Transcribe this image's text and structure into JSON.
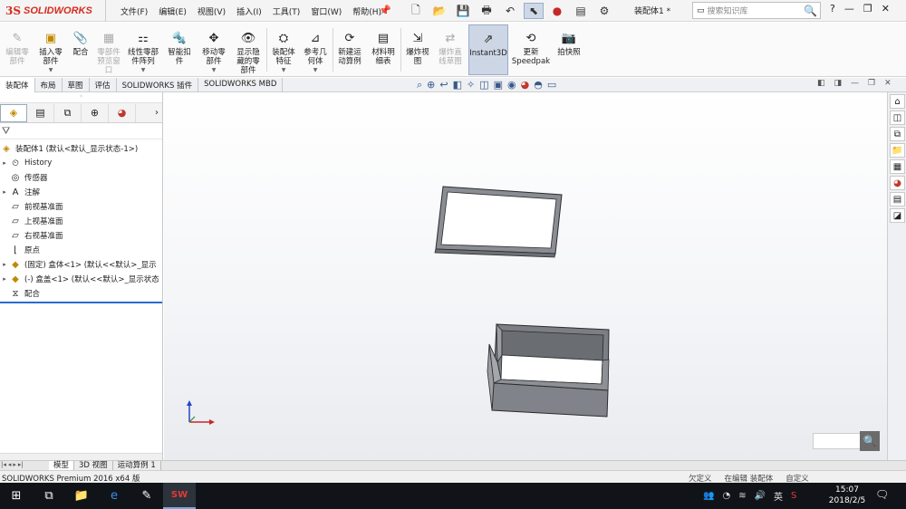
{
  "app": {
    "logo_ds": "3S",
    "logo_text": "SOLIDWORKS",
    "document_title": "装配体1 *"
  },
  "menu": [
    "文件(F)",
    "编辑(E)",
    "视图(V)",
    "插入(I)",
    "工具(T)",
    "窗口(W)",
    "帮助(H)"
  ],
  "quick_access": [
    "new-doc",
    "open",
    "save",
    "print",
    "undo",
    "select",
    "rebuild",
    "file-props",
    "options"
  ],
  "search": {
    "placeholder": "搜索知识库"
  },
  "title_buttons": {
    "help": "?",
    "minimize": "—",
    "restore": "❐",
    "close": "✕"
  },
  "ribbon": [
    {
      "label": "编辑零\n部件",
      "icon": "edit-part-icon",
      "disabled": true
    },
    {
      "label": "插入零\n部件",
      "icon": "insert-component-icon",
      "disabled": false,
      "dropdown": true
    },
    {
      "label": "配合",
      "icon": "mate-icon",
      "disabled": false
    },
    {
      "label": "零部件\n预览窗\n口",
      "icon": "component-preview-icon",
      "disabled": true
    },
    {
      "label": "线性零部\n件阵列",
      "icon": "linear-pattern-icon",
      "disabled": false,
      "dropdown": true
    },
    {
      "label": "智能扣\n件",
      "icon": "smart-fasteners-icon",
      "disabled": false
    },
    {
      "label": "移动零\n部件",
      "icon": "move-component-icon",
      "disabled": false,
      "dropdown": true
    },
    {
      "label": "显示隐\n藏的零\n部件",
      "icon": "show-hidden-icon",
      "disabled": false
    },
    {
      "label": "装配体\n特征",
      "icon": "assembly-features-icon",
      "disabled": false,
      "dropdown": true
    },
    {
      "label": "参考几\n何体",
      "icon": "reference-geometry-icon",
      "disabled": false,
      "dropdown": true
    },
    {
      "label": "新建运\n动算例",
      "icon": "new-motion-study-icon",
      "disabled": false
    },
    {
      "label": "材料明\n细表",
      "icon": "bom-icon",
      "disabled": false
    },
    {
      "label": "爆炸视\n图",
      "icon": "exploded-view-icon",
      "disabled": false
    },
    {
      "label": "爆炸直\n线草图",
      "icon": "explode-line-sketch-icon",
      "disabled": true
    },
    {
      "label": "Instant3D",
      "icon": "instant3d-icon",
      "disabled": false,
      "selected": true
    },
    {
      "label": "更新\nSpeedpak",
      "icon": "speedpak-icon",
      "disabled": false
    },
    {
      "label": "拍快照",
      "icon": "snapshot-icon",
      "disabled": false
    }
  ],
  "command_tabs": [
    "装配体",
    "布局",
    "草图",
    "评估",
    "SOLIDWORKS 插件",
    "SOLIDWORKS MBD"
  ],
  "feature_tree": {
    "root": "装配体1 (默认<默认_显示状态-1>)",
    "nodes": [
      {
        "label": "History",
        "icon": "history-icon",
        "expandable": true
      },
      {
        "label": "传感器",
        "icon": "sensor-icon",
        "expandable": false
      },
      {
        "label": "注解",
        "icon": "annotations-icon",
        "expandable": true
      },
      {
        "label": "前视基准面",
        "icon": "plane-icon",
        "expandable": false
      },
      {
        "label": "上视基准面",
        "icon": "plane-icon",
        "expandable": false
      },
      {
        "label": "右视基准面",
        "icon": "plane-icon",
        "expandable": false
      },
      {
        "label": "原点",
        "icon": "origin-icon",
        "expandable": false
      },
      {
        "label": "(固定) 盒体<1> (默认<<默认>_显示",
        "icon": "part-icon",
        "expandable": true
      },
      {
        "label": "(-) 盒盖<1> (默认<<默认>_显示状态",
        "icon": "part-icon",
        "expandable": true
      },
      {
        "label": "配合",
        "icon": "mates-folder-icon",
        "expandable": false
      }
    ]
  },
  "bottom_tabs": [
    "模型",
    "3D 视图",
    "运动算例 1"
  ],
  "status": {
    "left": "SOLIDWORKS Premium 2016 x64 版",
    "right": [
      "欠定义",
      "在编辑 装配体",
      "自定义"
    ]
  },
  "taskbar": {
    "ime": "英",
    "time": "15:07",
    "date": "2018/2/5"
  },
  "colors": {
    "accent": "#2a6bd1",
    "logo": "#d52b1e",
    "taskbar": "#101418"
  }
}
